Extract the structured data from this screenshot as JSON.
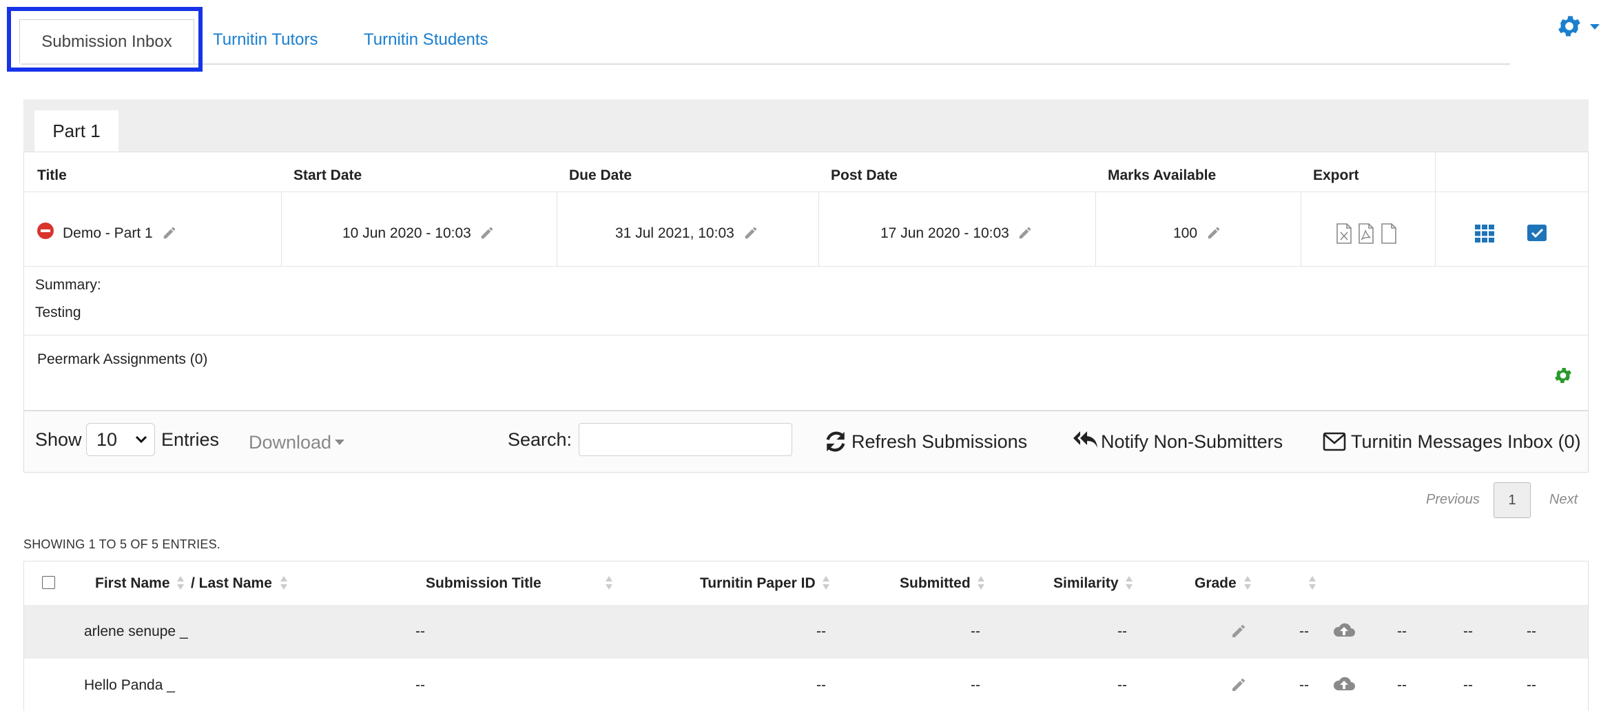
{
  "tabs": {
    "inbox": "Submission Inbox",
    "tutors": "Turnitin Tutors",
    "students": "Turnitin Students"
  },
  "part": {
    "label": "Part 1"
  },
  "assignment": {
    "headers": {
      "title": "Title",
      "start": "Start Date",
      "due": "Due Date",
      "post": "Post Date",
      "marks": "Marks Available",
      "export": "Export"
    },
    "title": "Demo - Part 1",
    "start": "10 Jun 2020 - 10:03",
    "due": "31 Jul 2021, 10:03",
    "post": "17 Jun 2020 - 10:03",
    "marks": "100",
    "summary_label": "Summary:",
    "summary_text": "Testing",
    "peermark": "Peermark Assignments (0)"
  },
  "controls": {
    "show": "Show",
    "entries_value": "10",
    "entries": "Entries",
    "download": "Download",
    "search_label": "Search:",
    "search_value": "",
    "refresh": "Refresh Submissions",
    "notify": "Notify Non-Submitters",
    "messages": "Turnitin Messages Inbox (0)"
  },
  "pagination": {
    "previous": "Previous",
    "page": "1",
    "next": "Next"
  },
  "showing": "SHOWING 1 TO 5 OF 5 ENTRIES.",
  "submissions": {
    "headers": {
      "first_name": "First Name",
      "last_name": "/ Last Name",
      "title": "Submission Title",
      "paper_id": "Turnitin Paper ID",
      "submitted": "Submitted",
      "similarity": "Similarity",
      "grade": "Grade"
    },
    "rows": [
      {
        "name": "arlene senupe _",
        "title": "--",
        "paper_id": "--",
        "submitted": "--",
        "similarity": "--",
        "grade": "--",
        "c1": "--",
        "c2": "--",
        "c3": "--"
      },
      {
        "name": "Hello Panda _",
        "title": "--",
        "paper_id": "--",
        "submitted": "--",
        "similarity": "--",
        "grade": "--",
        "c1": "--",
        "c2": "--",
        "c3": "--"
      }
    ]
  },
  "colors": {
    "link": "#1a7fcf",
    "highlight": "#1633e8",
    "green_gear": "#2a9a2a",
    "blue_icon": "#1e74b9",
    "red_status": "#d9342b"
  },
  "icons": [
    "gear-icon",
    "pencil-icon",
    "minus-circle-icon",
    "excel-file-icon",
    "pdf-file-icon",
    "file-icon",
    "grid-icon",
    "check-square-icon",
    "refresh-icon",
    "reply-all-icon",
    "envelope-icon",
    "cloud-upload-icon"
  ]
}
